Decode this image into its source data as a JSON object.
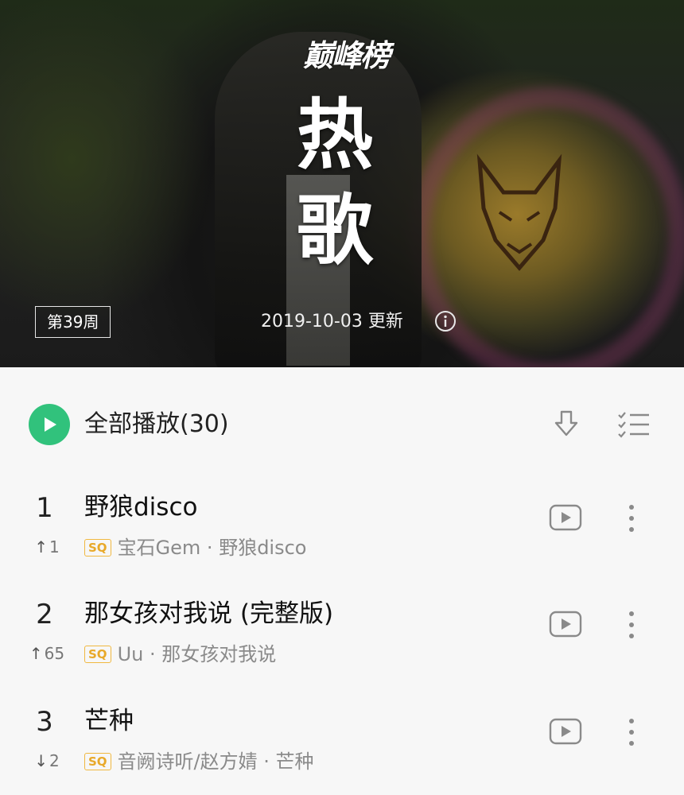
{
  "header": {
    "logo_text": "巅峰榜",
    "title": "热 歌",
    "week_badge": "第39周",
    "update_text": "2019-10-03 更新"
  },
  "play_all": {
    "label": "全部播放(30)"
  },
  "songs": [
    {
      "rank": "1",
      "change_dir": "up",
      "change_arrow": "↑",
      "change": "1",
      "title": "野狼disco",
      "quality": "SQ",
      "meta": "宝石Gem · 野狼disco"
    },
    {
      "rank": "2",
      "change_dir": "up",
      "change_arrow": "↑",
      "change": "65",
      "title": "那女孩对我说 (完整版)",
      "quality": "SQ",
      "meta": "Uu · 那女孩对我说"
    },
    {
      "rank": "3",
      "change_dir": "down",
      "change_arrow": "↓",
      "change": "2",
      "title": "芒种",
      "quality": "SQ",
      "meta": "音阙诗听/赵方婧 · 芒种"
    }
  ],
  "colors": {
    "accent": "#31c27c",
    "sq_badge": "#e8a92a"
  },
  "icons": {
    "play": "play-icon",
    "download": "download-icon",
    "multiselect": "multiselect-icon",
    "mv": "mv-play-icon",
    "more": "more-vertical-icon",
    "info": "info-icon"
  }
}
